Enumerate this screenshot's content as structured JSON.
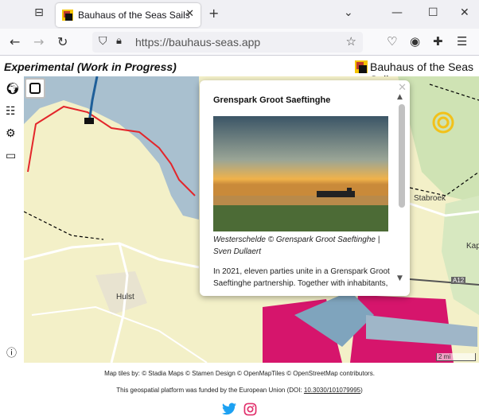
{
  "browser": {
    "tab_title": "Bauhaus of the Seas Sails",
    "url": "https://bauhaus-seas.app"
  },
  "app": {
    "mode_label": "Experimental (Work in Progress)",
    "title": "Bauhaus of the Seas Sails"
  },
  "map": {
    "labels": {
      "hulst": "Hulst",
      "stabroek": "Stabroek",
      "kapellen": "Kap",
      "highway": "A12"
    },
    "scale_label": "2 mi"
  },
  "popup": {
    "title": "Grenspark Groot Saeftinghe",
    "caption": "Westerschelde © Grenspark Groot Saeftinghe | Sven Dullaert",
    "body": "In 2021, eleven parties unite in a Grenspark Groot Saeftinghe partnership. Together with inhabitants,"
  },
  "footer": {
    "attribution": "Map tiles by: © Stadia Maps © Stamen Design © OpenMapTiles © OpenStreetMap contributors.",
    "funding_prefix": "This geospatial platform was funded by the European Union (DOI: ",
    "doi": "10.3030/101079995",
    "funding_suffix": ")"
  },
  "colors": {
    "border_red": "#e3262b",
    "water": "#a9c0cf",
    "land": "#f3f0c8",
    "port_magenta": "#d6156c",
    "target_yellow": "#f2c11a",
    "twitter_blue": "#1da1f2",
    "instagram_pink": "#e1306c"
  },
  "icons": [
    "globe-icon",
    "sliders-icon",
    "gears-icon",
    "map-icon",
    "info-icon",
    "square-draw-icon",
    "twitter-icon",
    "instagram-icon"
  ]
}
